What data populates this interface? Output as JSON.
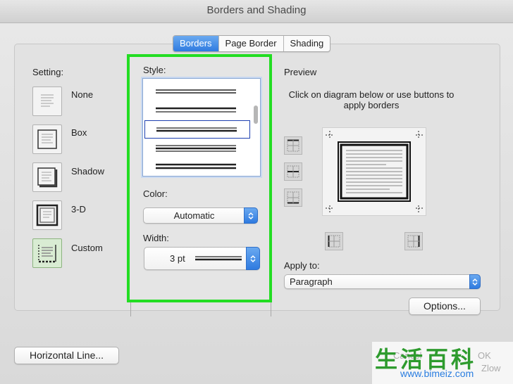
{
  "window": {
    "title": "Borders and Shading"
  },
  "tabs": [
    {
      "label": "Borders",
      "active": true
    },
    {
      "label": "Page Border",
      "active": false
    },
    {
      "label": "Shading",
      "active": false
    }
  ],
  "setting": {
    "heading": "Setting:",
    "options": [
      {
        "label": "None",
        "icon": "setting-none-icon"
      },
      {
        "label": "Box",
        "icon": "setting-box-icon"
      },
      {
        "label": "Shadow",
        "icon": "setting-shadow-icon"
      },
      {
        "label": "3-D",
        "icon": "setting-3d-icon"
      },
      {
        "label": "Custom",
        "icon": "setting-custom-icon",
        "selected": true
      }
    ]
  },
  "style": {
    "heading": "Style:",
    "selected_index": 2
  },
  "color": {
    "heading": "Color:",
    "value": "Automatic"
  },
  "width": {
    "heading": "Width:",
    "value": "3 pt"
  },
  "preview": {
    "heading": "Preview",
    "instructions_line1": "Click on diagram below or use buttons to",
    "instructions_line2": "apply borders"
  },
  "apply_to": {
    "heading": "Apply to:",
    "value": "Paragraph"
  },
  "buttons": {
    "options": "Options...",
    "horizontal_line": "Horizontal Line..."
  },
  "watermark": {
    "chars": "生活百科",
    "url": "www.bimeiz.com",
    "ghost1": "Cancel",
    "ghost2": "OK",
    "ghost3": "Zlow"
  },
  "colors": {
    "highlight": "#22dd22",
    "accent": "#2f7be0"
  }
}
